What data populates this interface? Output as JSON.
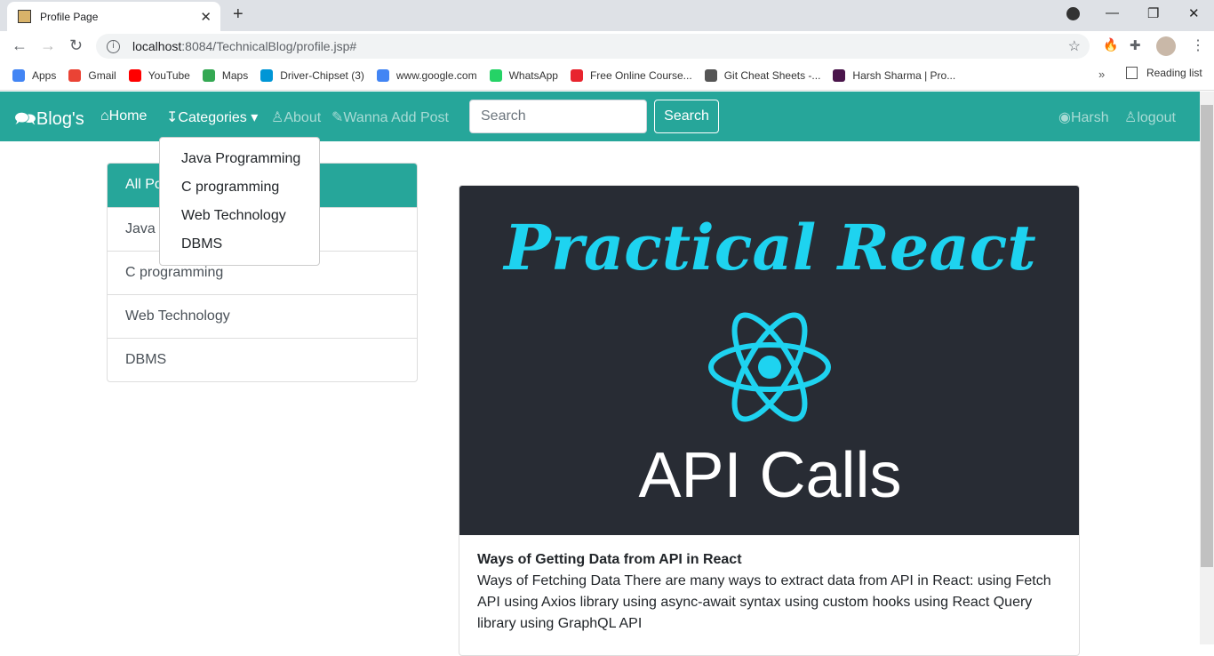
{
  "browser": {
    "tab_title": "Profile Page",
    "url_host": "localhost",
    "url_rest": ":8084/TechnicalBlog/profile.jsp#",
    "bookmarks": [
      {
        "label": "Apps",
        "color": "#4285f4"
      },
      {
        "label": "Gmail",
        "color": "#ea4335"
      },
      {
        "label": "YouTube",
        "color": "#ff0000"
      },
      {
        "label": "Maps",
        "color": "#34a853"
      },
      {
        "label": "Driver-Chipset (3)",
        "color": "#0096d6"
      },
      {
        "label": "www.google.com",
        "color": "#4285f4"
      },
      {
        "label": "WhatsApp",
        "color": "#25d366"
      },
      {
        "label": "Free Online Course...",
        "color": "#e8242e"
      },
      {
        "label": "Git Cheat Sheets -...",
        "color": "#555555"
      },
      {
        "label": "Harsh Sharma | Pro...",
        "color": "#4a154b"
      }
    ],
    "reading_list": "Reading list"
  },
  "navbar": {
    "brand": "Blog's",
    "home": "Home",
    "categories": "Categories",
    "about": "About",
    "add_post": "Wanna Add Post",
    "search_placeholder": "Search",
    "search_button": "Search",
    "user": "Harsh",
    "logout": "logout",
    "color": "#26a69a"
  },
  "dropdown": [
    "Java Programming",
    "C programming",
    "Web Technology",
    "DBMS"
  ],
  "sidebar": [
    "All Posts",
    "Java Programming",
    "C programming",
    "Web Technology",
    "DBMS"
  ],
  "post": {
    "image_title": "Practical React",
    "image_subtitle": "API Calls",
    "title": "Ways of Getting Data from API in React",
    "body": "Ways of Fetching Data There are many ways to extract data from API in React: using Fetch API using Axios library using async-await syntax using custom hooks using React Query library using GraphQL API"
  }
}
